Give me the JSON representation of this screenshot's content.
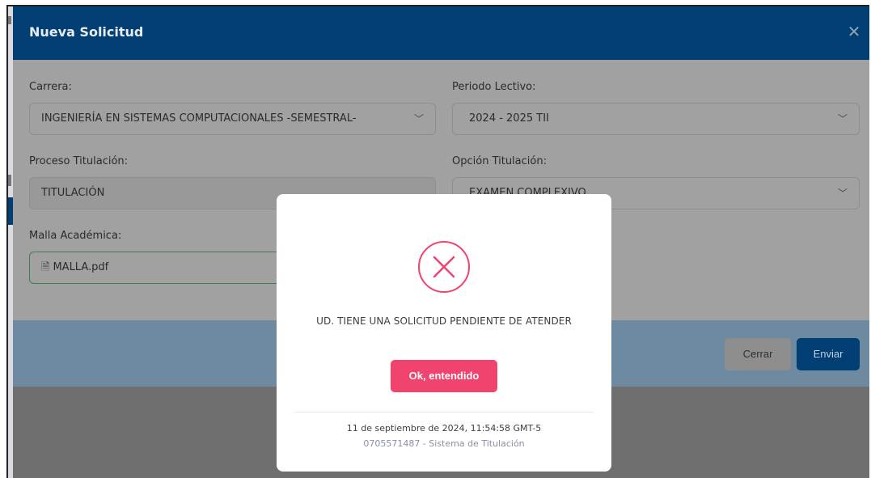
{
  "modal": {
    "title": "Nueva Solicitud",
    "close_icon": "close-icon",
    "carrera": {
      "label": "Carrera:",
      "value": "INGENIERÍA EN SISTEMAS COMPUTACIONALES -SEMESTRAL-"
    },
    "periodo": {
      "label": "Periodo Lectivo:",
      "value": "2024 - 2025 TII"
    },
    "proceso": {
      "label": "Proceso Titulación:",
      "value": "TITULACIÓN"
    },
    "opcion": {
      "label": "Opción Titulación:",
      "value": "EXAMEN COMPLEXIVO"
    },
    "malla": {
      "label": "Malla Académica:",
      "file": "MALLA.pdf"
    },
    "footer": {
      "cerrar": "Cerrar",
      "enviar": "Enviar"
    }
  },
  "alert": {
    "icon": "error-x-icon",
    "icon_color": "#f0446f",
    "message": "UD. TIENE UNA SOLICITUD PENDIENTE DE ATENDER",
    "button": "Ok, entendido",
    "timestamp": "11 de septiembre de 2024, 11:54:58 GMT-5",
    "system": "0705571487 - Sistema de Titulación"
  },
  "colors": {
    "primary": "#003e74",
    "accent": "#f0446f"
  }
}
